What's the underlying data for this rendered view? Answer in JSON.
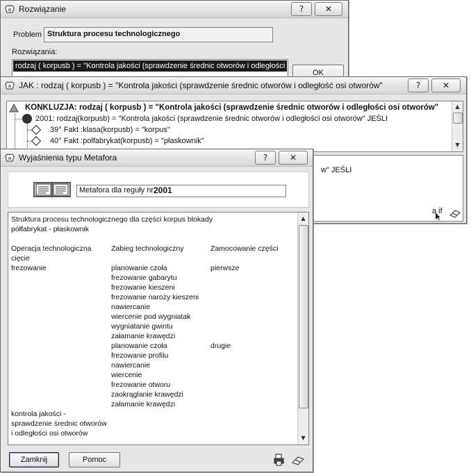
{
  "rozw": {
    "title": "Rozwiązanie",
    "help": "?",
    "close": "✕",
    "problem_label": "Problem",
    "problem_value": "Struktura procesu technologicznego",
    "solutions_label": "Rozwiązania:",
    "solution_item": "rodzaj ( korpusb ) = \"Kontrola jakości (sprawdzenie średnic otworów i odległości",
    "ok": "OK"
  },
  "jak": {
    "title": "JAK : rodzaj ( korpusb ) = \"Kontrola jakości (sprawdzenie średnic otworów i odległość osi otworów\"",
    "help": "?",
    "close": "✕",
    "conclusion": "KONKLUZJA: rodzaj ( korpusb ) = \"Kontrola jakości (sprawdzenie średnic otworów i odległości osi otworów\"",
    "rule": "2001: rodzaj(korpusb) = \"Kontrola jakości (sprawdzenie średnic otworów i odległości osi otworów\" JEŚLI",
    "facts": [
      "39° Fakt :klasa(korpusb) = \"korpus\"",
      "40° Fakt :polfabrykat(korpusb) = \"płaskownik\""
    ],
    "lower_text": "w\" JEŚLI",
    "aif_label": "a if"
  },
  "meta": {
    "title": "Wyjaśnienia typu Metafora",
    "help": "?",
    "close": "✕",
    "field_prefix": "Metafora dla reguły nr",
    "field_number": "2001",
    "intro1": "Struktura procesu technologicznego dla części korpus blokady",
    "intro2": "półfabrykat - płaskownik",
    "headers": [
      "Operacja technologiczna",
      "Zabieg technologiczny",
      "Zamocowanie części"
    ],
    "op1": "cięcie",
    "op2": "frezowanie",
    "group1": [
      "planowanie czoła",
      "frezowanie gabarytu",
      "frezowanie kieszeni",
      "frezowanie naroży kieszeni",
      "nawiercanie",
      "wiercenie pod wygniatak",
      "wygniatanie gwintu",
      "załamanie krawędzi"
    ],
    "mount1": "pierwsze",
    "group2": [
      "planowanie czoła",
      "frezowanie profilu",
      "nawiercanie",
      "wiercenie",
      "frezowanie otworu",
      "zaokrąglanie krawędzi",
      "załamanie krawędzi"
    ],
    "mount2": "drugie",
    "op3": [
      "kontrola jakości -",
      "sprawdzenie średnic otworów",
      "i odległości osi otworów"
    ],
    "close_btn": "Zamknij",
    "help_btn": "Pomoc"
  }
}
